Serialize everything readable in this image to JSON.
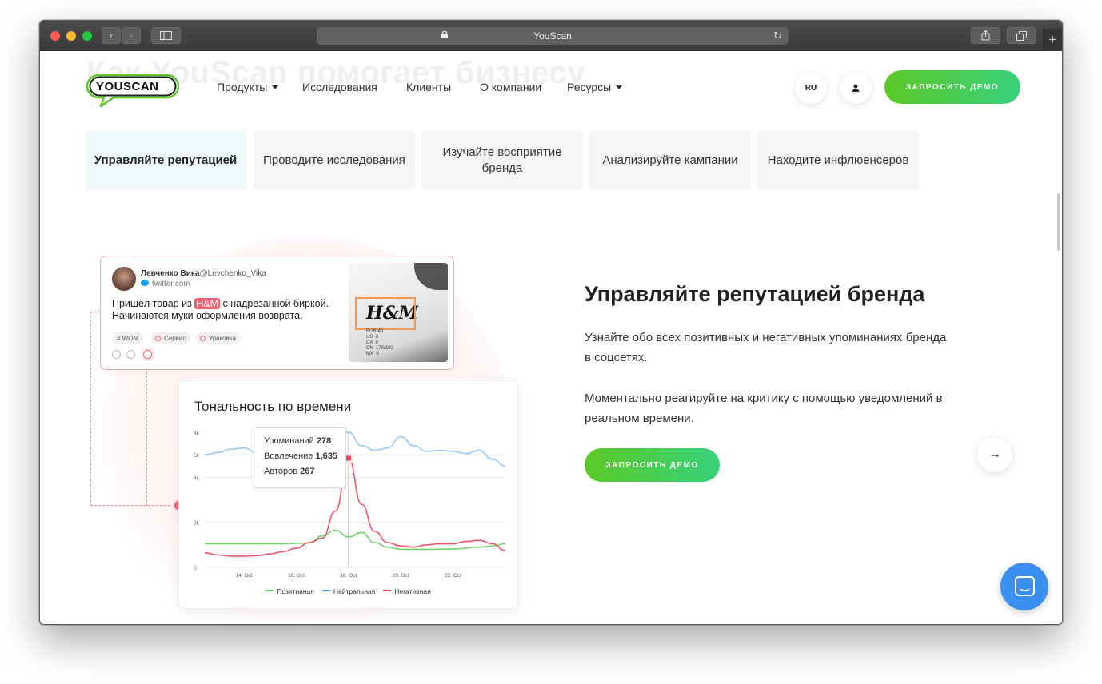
{
  "browser": {
    "url_title": "YouScan",
    "buttons": {
      "back": "‹",
      "forward": "›",
      "new_tab": "+"
    }
  },
  "page": {
    "ghost_heading": "Как YouScan помогает бизнесу",
    "logo_text": "YOUSCAN",
    "nav": [
      {
        "label": "Продукты",
        "dropdown": true
      },
      {
        "label": "Исследования",
        "dropdown": false
      },
      {
        "label": "Клиенты",
        "dropdown": false
      },
      {
        "label": "О компании",
        "dropdown": false
      },
      {
        "label": "Ресурсы",
        "dropdown": true
      }
    ],
    "lang": "RU",
    "header_demo": "ЗАПРОСИТЬ ДЕМО",
    "tabs": [
      {
        "label": "Управляйте репутацией",
        "active": true
      },
      {
        "label": "Проводите исследования",
        "active": false
      },
      {
        "label": "Изучайте восприятие бренда",
        "active": false
      },
      {
        "label": "Анализируйте кампании",
        "active": false
      },
      {
        "label": "Находите инфлюенсеров",
        "active": false
      }
    ],
    "tweet": {
      "author_name": "Левченко Вика",
      "author_handle": "@Levchenko_Vika",
      "source": "twitter.com",
      "text_before": "Пришёл товар из ",
      "brand": "H&M",
      "text_after": " с надрезанной биркой. Начинаются муки оформления возврата.",
      "tags": [
        "# WOM",
        "Сервис",
        "Упаковка"
      ],
      "label_image_text": "H&M",
      "label_sizes": "EUR 40\nUS  8\nCA  8\nCN  170/100\nMX  8"
    },
    "content": {
      "heading": "Управляйте репутацией бренда",
      "paragraph1": "Узнайте обо всех позитивных и негативных упоминаниях бренда в соцсетях.",
      "paragraph2": "Моментально реагируйте на критику с помощью уведомлений в реальном времени.",
      "demo_button": "ЗАПРОСИТЬ ДЕМО",
      "next_arrow": "→"
    }
  },
  "chart_data": {
    "type": "line",
    "title": "Тональность по времени",
    "x_ticks": [
      "14. Oct",
      "16. Oct",
      "18. Oct",
      "20. Oct",
      "22. Oct"
    ],
    "y_ticks": [
      "0",
      "2k",
      "4k",
      "5k",
      "6k"
    ],
    "xlim": [
      12.5,
      24
    ],
    "ylim": [
      0,
      6000
    ],
    "series": [
      {
        "name": "Позитивная",
        "color": "#5fd35a",
        "x": [
          12.5,
          13.5,
          14.5,
          15.5,
          16.5,
          17.0,
          17.5,
          18.0,
          18.5,
          19.0,
          19.5,
          20.0,
          21.0,
          22.0,
          23.0,
          23.5,
          24.0
        ],
        "values": [
          1050,
          1050,
          1050,
          1050,
          1080,
          1400,
          1650,
          1350,
          1550,
          1100,
          900,
          800,
          800,
          820,
          900,
          950,
          1050
        ]
      },
      {
        "name": "Нейтральная",
        "color": "#3ea0f0",
        "x": [
          12.5,
          13.0,
          13.5,
          14.0,
          14.5,
          15.0,
          15.5,
          16.0,
          16.5,
          17.0,
          17.5,
          18.0,
          18.5,
          19.0,
          19.5,
          20.0,
          20.5,
          21.0,
          21.5,
          22.0,
          22.5,
          23.0,
          23.5,
          24.0
        ],
        "values": [
          5000,
          5100,
          5250,
          5300,
          5100,
          5300,
          5350,
          5100,
          4800,
          4700,
          5600,
          6000,
          5400,
          5200,
          5300,
          5800,
          5400,
          5150,
          5200,
          5150,
          5050,
          5200,
          4800,
          4500
        ]
      },
      {
        "name": "Негативная",
        "color": "#f0405a",
        "x": [
          12.5,
          13.0,
          13.5,
          14.0,
          14.5,
          15.0,
          15.5,
          16.0,
          16.5,
          17.0,
          17.5,
          18.0,
          18.5,
          19.0,
          19.5,
          20.0,
          20.5,
          21.0,
          21.5,
          22.0,
          22.5,
          23.0,
          23.5,
          24.0
        ],
        "values": [
          650,
          550,
          500,
          500,
          520,
          600,
          700,
          850,
          1100,
          1300,
          2500,
          4850,
          2800,
          1600,
          1100,
          950,
          900,
          1000,
          1050,
          1050,
          1150,
          1200,
          1050,
          750
        ]
      }
    ],
    "tooltip": {
      "x": 18.0,
      "rows": [
        {
          "label": "Упоминаний",
          "value": "278"
        },
        {
          "label": "Вовлечение",
          "value": "1,635"
        },
        {
          "label": "Авторов",
          "value": "267"
        }
      ]
    },
    "legend": [
      "Позитивная",
      "Нейтральная",
      "Негативная"
    ]
  }
}
